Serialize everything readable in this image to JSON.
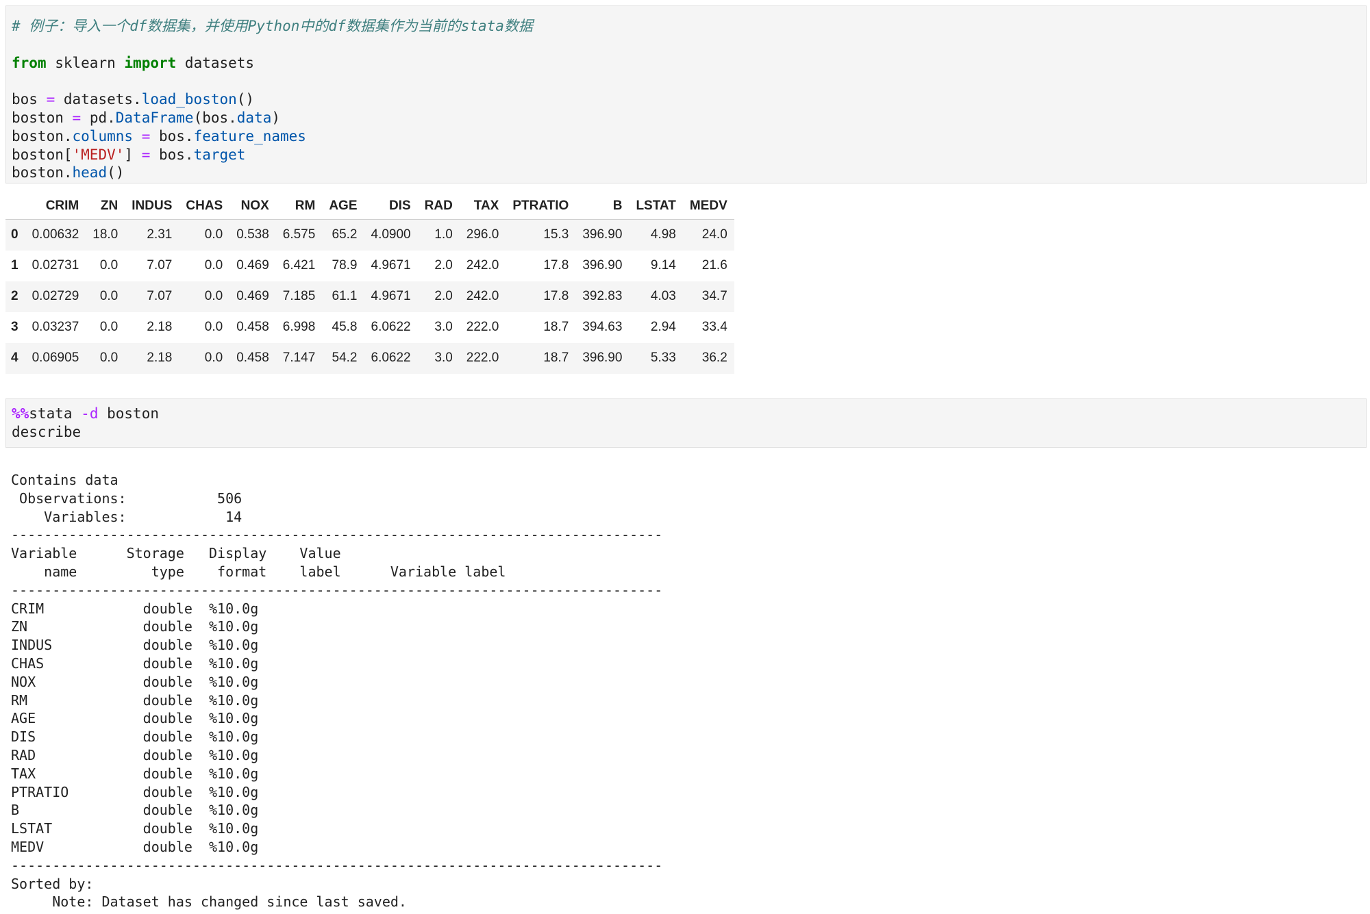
{
  "cell1": {
    "comment": "# 例子：导入一个df数据集，并使用Python中的df数据集作为当前的stata数据",
    "kw_from": "from",
    "module": "sklearn",
    "kw_import": "import",
    "import_name": "datasets",
    "l3_var": "bos",
    "l3_eq": "=",
    "l3_obj": "datasets.",
    "l3_attr": "load_boston",
    "l3_end": "()",
    "l4_var": "boston",
    "l4_eq": "=",
    "l4_obj": "pd.",
    "l4_attr": "DataFrame",
    "l4_arg": "(bos.",
    "l4_argattr": "data",
    "l4_end": ")",
    "l5_obj": "boston.",
    "l5_attr": "columns",
    "l5_eq": "=",
    "l5_val": "bos.",
    "l5_valattr": "feature_names",
    "l6_obj": "boston[",
    "l6_str": "'MEDV'",
    "l6_close": "]",
    "l6_eq": "=",
    "l6_val": "bos.",
    "l6_valattr": "target",
    "l7_obj": "boston.",
    "l7_attr": "head",
    "l7_end": "()"
  },
  "dataframe": {
    "columns": [
      "",
      "CRIM",
      "ZN",
      "INDUS",
      "CHAS",
      "NOX",
      "RM",
      "AGE",
      "DIS",
      "RAD",
      "TAX",
      "PTRATIO",
      "B",
      "LSTAT",
      "MEDV"
    ],
    "rows": [
      [
        "0",
        "0.00632",
        "18.0",
        "2.31",
        "0.0",
        "0.538",
        "6.575",
        "65.2",
        "4.0900",
        "1.0",
        "296.0",
        "15.3",
        "396.90",
        "4.98",
        "24.0"
      ],
      [
        "1",
        "0.02731",
        "0.0",
        "7.07",
        "0.0",
        "0.469",
        "6.421",
        "78.9",
        "4.9671",
        "2.0",
        "242.0",
        "17.8",
        "396.90",
        "9.14",
        "21.6"
      ],
      [
        "2",
        "0.02729",
        "0.0",
        "7.07",
        "0.0",
        "0.469",
        "7.185",
        "61.1",
        "4.9671",
        "2.0",
        "242.0",
        "17.8",
        "392.83",
        "4.03",
        "34.7"
      ],
      [
        "3",
        "0.03237",
        "0.0",
        "2.18",
        "0.0",
        "0.458",
        "6.998",
        "45.8",
        "6.0622",
        "3.0",
        "222.0",
        "18.7",
        "394.63",
        "2.94",
        "33.4"
      ],
      [
        "4",
        "0.06905",
        "0.0",
        "2.18",
        "0.0",
        "0.458",
        "7.147",
        "54.2",
        "6.0622",
        "3.0",
        "222.0",
        "18.7",
        "396.90",
        "5.33",
        "36.2"
      ]
    ]
  },
  "cell2": {
    "magic": "%%",
    "cmd": "stata",
    "flag": "-d",
    "arg": "boston",
    "line2": "describe"
  },
  "stata_output": {
    "lines": [
      "Contains data",
      " Observations:           506",
      "    Variables:            14",
      "-------------------------------------------------------------------------------",
      "Variable      Storage   Display    Value",
      "    name         type    format    label      Variable label",
      "-------------------------------------------------------------------------------",
      "CRIM            double  %10.0g",
      "ZN              double  %10.0g",
      "INDUS           double  %10.0g",
      "CHAS            double  %10.0g",
      "NOX             double  %10.0g",
      "RM              double  %10.0g",
      "AGE             double  %10.0g",
      "DIS             double  %10.0g",
      "RAD             double  %10.0g",
      "TAX             double  %10.0g",
      "PTRATIO         double  %10.0g",
      "B               double  %10.0g",
      "LSTAT           double  %10.0g",
      "MEDV            double  %10.0g",
      "-------------------------------------------------------------------------------",
      "Sorted by:",
      "     Note: Dataset has changed since last saved."
    ]
  }
}
